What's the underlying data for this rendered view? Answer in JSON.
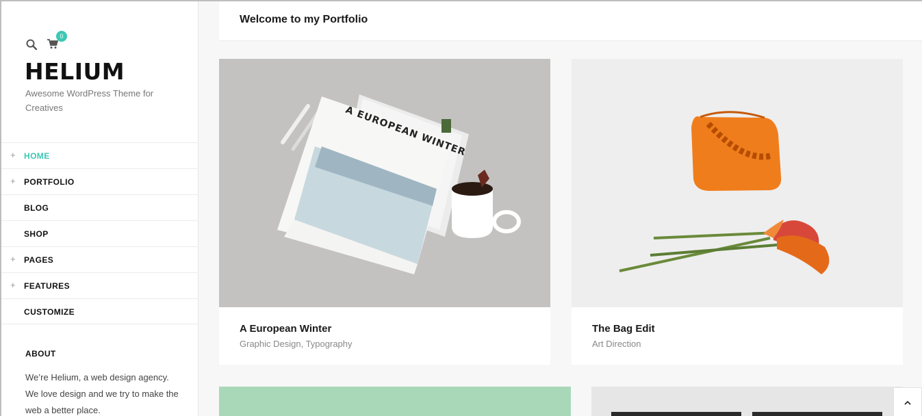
{
  "sidebar": {
    "cart_count": "0",
    "logo": "HELIUM",
    "tagline": "Awesome WordPress Theme for Creatives",
    "nav": [
      {
        "label": "HOME",
        "expandable": true,
        "active": true
      },
      {
        "label": "PORTFOLIO",
        "expandable": true,
        "active": false
      },
      {
        "label": "BLOG",
        "expandable": false,
        "active": false
      },
      {
        "label": "SHOP",
        "expandable": false,
        "active": false
      },
      {
        "label": "PAGES",
        "expandable": true,
        "active": false
      },
      {
        "label": "FEATURES",
        "expandable": true,
        "active": false
      },
      {
        "label": "CUSTOMIZE",
        "expandable": false,
        "active": false
      }
    ],
    "plus_symbol": "+",
    "about_title": "ABOUT",
    "about_text": "We’re Helium, a web design agency. We love design and we try to make the web a better place."
  },
  "main": {
    "page_title": "Welcome to my Portfolio",
    "cards": [
      {
        "title": "A European Winter",
        "categories": "Graphic Design, Typography",
        "image_text": "A EUROPEAN WINTER"
      },
      {
        "title": "The Bag Edit",
        "categories": "Art Direction"
      }
    ]
  },
  "icons": {
    "search": "search-icon",
    "cart": "cart-icon",
    "scroll_top": "chevron-up-icon"
  },
  "colors": {
    "accent": "#3cc8b4",
    "text_dark": "#111111",
    "text_muted": "#888888"
  }
}
